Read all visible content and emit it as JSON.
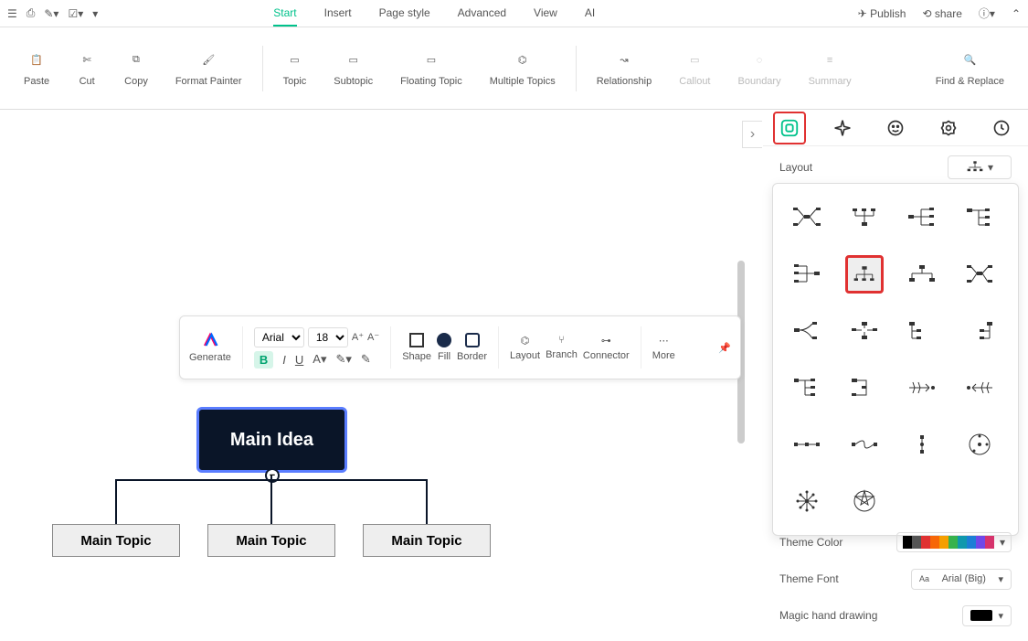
{
  "topbar": {
    "tabs": [
      "Start",
      "Insert",
      "Page style",
      "Advanced",
      "View",
      "AI"
    ],
    "active": "Start",
    "publish": "Publish",
    "share": "share"
  },
  "ribbon": {
    "paste": "Paste",
    "cut": "Cut",
    "copy": "Copy",
    "format_painter": "Format Painter",
    "topic": "Topic",
    "subtopic": "Subtopic",
    "floating_topic": "Floating Topic",
    "multiple_topics": "Multiple Topics",
    "relationship": "Relationship",
    "callout": "Callout",
    "boundary": "Boundary",
    "summary": "Summary",
    "find_replace": "Find & Replace"
  },
  "float_toolbar": {
    "generate": "Generate",
    "font": "Arial",
    "size": "18",
    "shape": "Shape",
    "fill": "Fill",
    "border": "Border",
    "layout": "Layout",
    "branch": "Branch",
    "connector": "Connector",
    "more": "More"
  },
  "mindmap": {
    "main_idea": "Main Idea",
    "topics": [
      "Main Topic",
      "Main Topic",
      "Main Topic"
    ]
  },
  "panel": {
    "layout_label": "Layout",
    "theme_color": "Theme Color",
    "theme_font": "Theme Font",
    "theme_font_value": "Arial (Big)",
    "magic_hand": "Magic hand drawing",
    "colors": [
      "#000",
      "#555",
      "#e03131",
      "#f76707",
      "#f59f00",
      "#37b24d",
      "#1098ad",
      "#1c7ed6",
      "#7048e8",
      "#d6336c"
    ]
  }
}
